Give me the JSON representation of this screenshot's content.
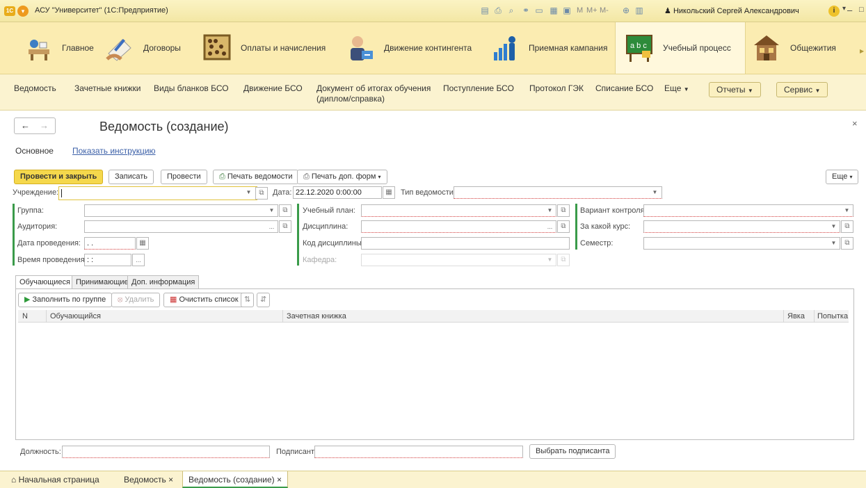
{
  "window": {
    "title": "АСУ \"Университет\" (1С:Предприятие)",
    "logo_text": "1С",
    "user": "Никольский Сергей Александрович",
    "panel_labels": [
      "M",
      "M+",
      "M-"
    ],
    "controls": [
      "‒",
      "□",
      "✕"
    ]
  },
  "sections": [
    {
      "label": "Главное",
      "icon": "desk-icon"
    },
    {
      "label": "Договоры",
      "icon": "signing-contract-icon"
    },
    {
      "label": "Оплаты и начисления",
      "icon": "abacus-icon"
    },
    {
      "label": "Движение контингента",
      "icon": "person-transfer-icon"
    },
    {
      "label": "Приемная кампания",
      "icon": "growth-person-icon"
    },
    {
      "label": "Учебный процесс",
      "icon": "chalkboard-icon",
      "active": true
    },
    {
      "label": "Общежития",
      "icon": "dormitory-house-icon"
    }
  ],
  "functions": {
    "links": [
      "Ведомость",
      "Зачетные книжки",
      "Виды бланков БСО",
      "Движение БСО",
      "Документ об итогах обучения (диплом/справка)",
      "Поступление БСО",
      "Протокол ГЭК",
      "Списание БСО"
    ],
    "more": "Еще",
    "reports": "Отчеты",
    "service": "Сервис"
  },
  "form": {
    "title": "Ведомость (создание)",
    "tab_main": "Основное",
    "tab_link": "Показать инструкцию",
    "buttons": {
      "post_close": "Провести и закрыть",
      "save": "Записать",
      "post": "Провести",
      "print_statement": "Печать ведомости",
      "print_extra": "Печать доп. форм",
      "more": "Еще"
    },
    "fields": {
      "institution": {
        "label": "Учреждение:",
        "value": ""
      },
      "date": {
        "label": "Дата:",
        "value": "22.12.2020 0:00:00"
      },
      "statement_type": {
        "label": "Тип ведомости:",
        "value": ""
      },
      "group": {
        "label": "Группа:",
        "value": ""
      },
      "auditorium": {
        "label": "Аудитория:",
        "value": ""
      },
      "event_date": {
        "label": "Дата проведения:",
        "value": " .  ."
      },
      "event_time": {
        "label": "Время проведения:",
        "value": " :  :"
      },
      "study_plan": {
        "label": "Учебный план:",
        "value": ""
      },
      "discipline": {
        "label": "Дисциплина:",
        "value": ""
      },
      "discipline_code": {
        "label": "Код дисциплины:",
        "value": ""
      },
      "department": {
        "label": "Кафедра:",
        "value": ""
      },
      "control_variant": {
        "label": "Вариант контроля:",
        "value": ""
      },
      "course": {
        "label": "За какой курс:",
        "value": ""
      },
      "semester": {
        "label": "Семестр:",
        "value": ""
      }
    },
    "subtabs": [
      "Обучающиеся",
      "Принимающие",
      "Доп. информация"
    ],
    "table_toolbar": {
      "fill": "Заполнить по группе",
      "delete": "Удалить",
      "clear": "Очистить список"
    },
    "table_columns": [
      "N",
      "Обучающийся",
      "Зачетная книжка",
      "Явка",
      "Попытка"
    ],
    "table_rows": [],
    "footer": {
      "position_label": "Должность:",
      "position_value": "",
      "signer_label": "Подписант:",
      "signer_value": "",
      "choose_signer": "Выбрать подписанта"
    }
  },
  "bottom_tabs": [
    "Начальная страница",
    "Ведомость",
    "Ведомость (создание)"
  ],
  "colors": {
    "accent_yellow": "#f5d84c",
    "required_underline": "#d23b3b",
    "group_bar_green": "#3a9b4a",
    "link_blue": "#3c60a8"
  }
}
